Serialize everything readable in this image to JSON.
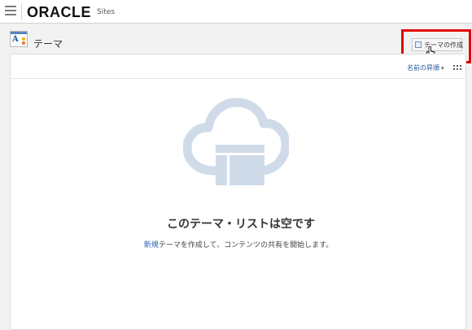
{
  "header": {
    "brand": "ORACLE",
    "product": "Sites"
  },
  "page": {
    "title": "テーマ",
    "create_button_label": "テーマの作成"
  },
  "toolbar": {
    "sort_label": "名前の昇順",
    "sort_caret": "▾"
  },
  "empty_state": {
    "title": "このテーマ・リストは空です",
    "desc_link": "新規",
    "desc_text": "テーマを作成して、コンテンツの共有を開始します。"
  },
  "colors": {
    "highlight": "#e00000",
    "link": "#2a66b2",
    "illustration": "#cfdbe8"
  },
  "icons": {
    "menu": "hamburger-menu-icon",
    "page": "theme-icon",
    "create": "create-theme-icon",
    "grid": "grid-view-icon",
    "illustration": "cloud-layout-illustration",
    "cursor": "hand-cursor-icon"
  }
}
